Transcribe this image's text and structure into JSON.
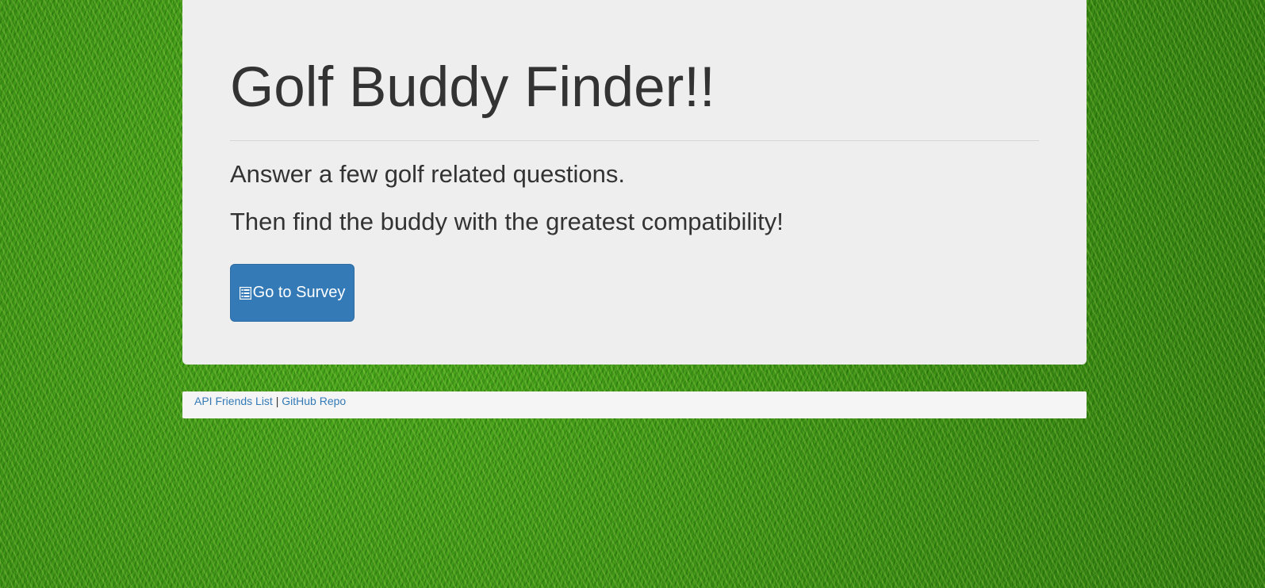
{
  "jumbotron": {
    "title": "Golf Buddy Finder!!",
    "lead_1": "Answer a few golf related questions.",
    "lead_2": "Then find the buddy with the greatest compatibility!",
    "survey_button_label": "Go to Survey",
    "survey_button_icon": "list-alt-icon",
    "button_color": "#337ab7"
  },
  "footer": {
    "link_1": "API Friends List",
    "separator": "|",
    "link_2": "GitHub Repo",
    "link_color": "#337ab7"
  }
}
